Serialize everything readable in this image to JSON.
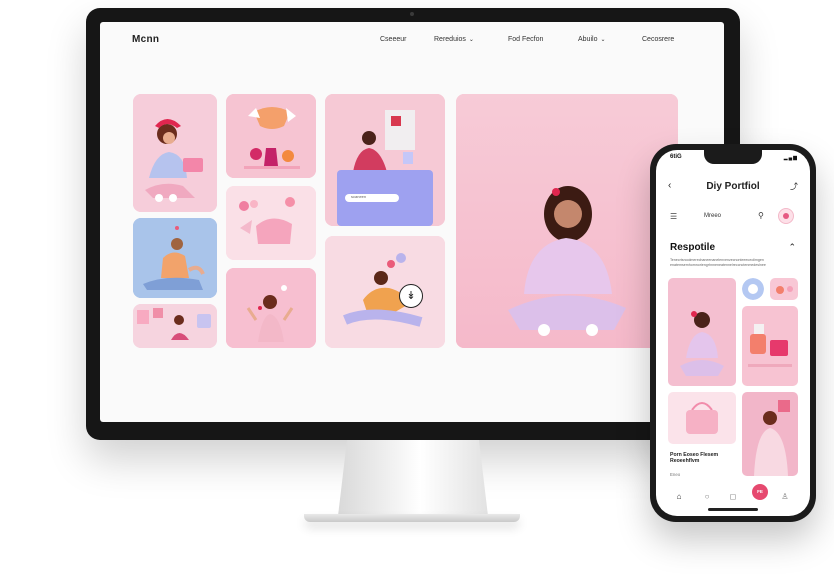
{
  "desktop": {
    "logo": "Mcnn",
    "nav": [
      {
        "label": "Cseeeur"
      },
      {
        "label": "Rereduios",
        "has_dropdown": true
      },
      {
        "label": "Fod Fecfon"
      },
      {
        "label": "Abuilo",
        "has_dropdown": true
      },
      {
        "label": "Cecosrere"
      }
    ],
    "search_bar": "scaneen"
  },
  "phone": {
    "time": "6tiG",
    "status_icons": "▂▄▆",
    "title": "Diy Portfiol",
    "subtitle": "Mreeo",
    "section_title": "Respotile",
    "description": "Tenecrtsnoolmerechaneenanelenvenzecnonteeeceolimgen enatemsemhomnoriengrhnneneatennelreccnctenmedeslnee",
    "caption_title": "Porn Eoseo Flesem Reoeehflvm",
    "caption_sub": "Eneo",
    "badge": "FE"
  },
  "colors": {
    "accent": "#e6496f",
    "pink_bg": "#f7c9d6",
    "lavender": "#d7d2f4",
    "blue_bg": "#a9c4ea"
  }
}
